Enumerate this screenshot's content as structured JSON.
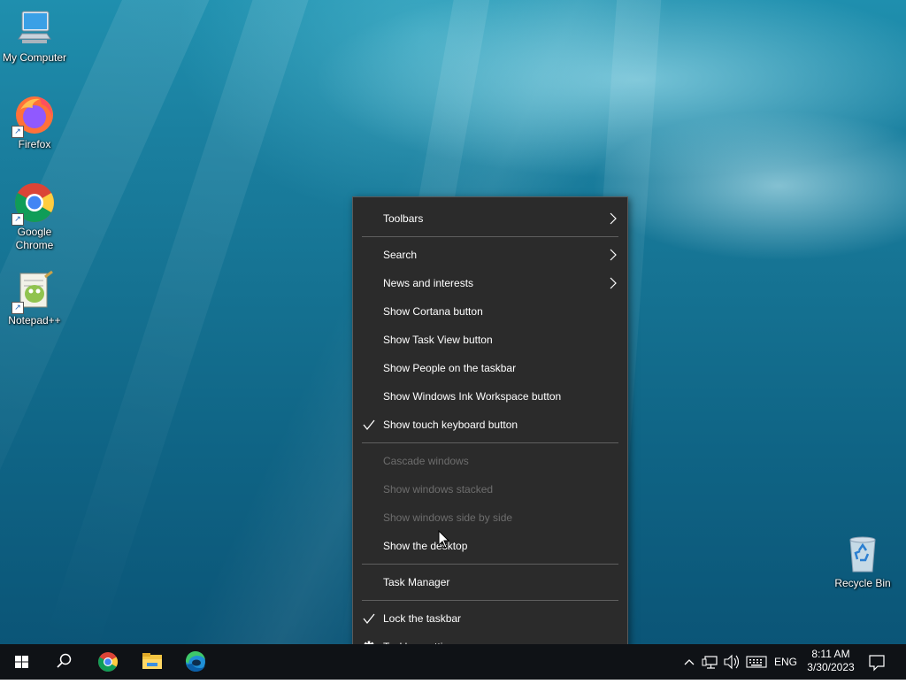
{
  "desktop": {
    "icons": [
      {
        "label": "My Computer",
        "icon": "computer-icon"
      },
      {
        "label": "Firefox",
        "icon": "firefox-icon"
      },
      {
        "label": "Google Chrome",
        "icon": "chrome-icon"
      },
      {
        "label": "Notepad++",
        "icon": "notepadpp-icon"
      },
      {
        "label": "Recycle Bin",
        "icon": "recycle-bin-icon"
      }
    ]
  },
  "context_menu": {
    "items": [
      {
        "label": "Toolbars",
        "submenu": true,
        "enabled": true
      },
      {
        "label": "Search",
        "submenu": true,
        "enabled": true
      },
      {
        "label": "News and interests",
        "submenu": true,
        "enabled": true
      },
      {
        "label": "Show Cortana button",
        "enabled": true
      },
      {
        "label": "Show Task View button",
        "enabled": true
      },
      {
        "label": "Show People on the taskbar",
        "enabled": true
      },
      {
        "label": "Show Windows Ink Workspace button",
        "enabled": true
      },
      {
        "label": "Show touch keyboard button",
        "checked": true,
        "enabled": true
      },
      {
        "label": "Cascade windows",
        "enabled": false
      },
      {
        "label": "Show windows stacked",
        "enabled": false
      },
      {
        "label": "Show windows side by side",
        "enabled": false
      },
      {
        "label": "Show the desktop",
        "enabled": true
      },
      {
        "label": "Task Manager",
        "enabled": true
      },
      {
        "label": "Lock the taskbar",
        "checked": true,
        "enabled": true
      },
      {
        "label": "Taskbar settings",
        "icon": "gear-icon",
        "enabled": true
      }
    ]
  },
  "taskbar": {
    "pinned": [
      "start-icon",
      "search-icon",
      "chrome-icon",
      "file-explorer-icon",
      "edge-icon"
    ],
    "tray": {
      "language": "ENG",
      "time": "8:11 AM",
      "date": "3/30/2023"
    }
  },
  "colors": {
    "menu_bg": "#2b2b2b",
    "menu_text": "#ffffff",
    "menu_disabled_text": "#6d6d6d",
    "taskbar_bg": "#0f1216"
  }
}
